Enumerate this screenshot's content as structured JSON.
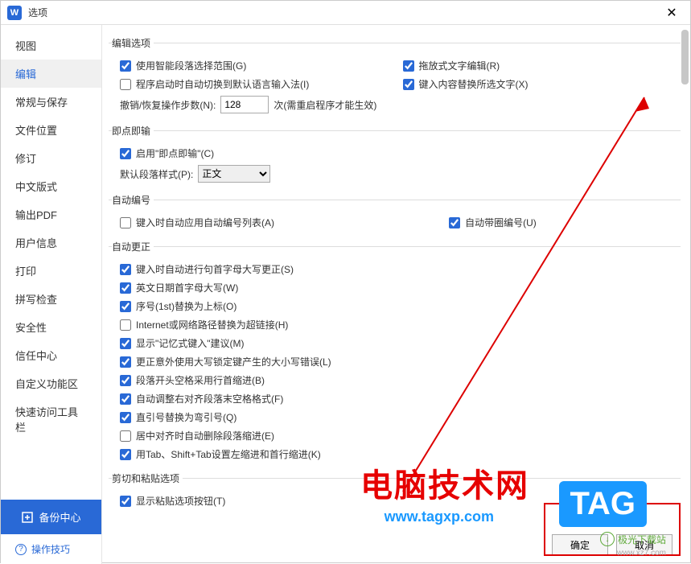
{
  "window": {
    "title": "选项",
    "close": "✕"
  },
  "sidebar": {
    "items": [
      "视图",
      "编辑",
      "常规与保存",
      "文件位置",
      "修订",
      "中文版式",
      "输出PDF",
      "用户信息",
      "打印",
      "拼写检查",
      "安全性",
      "信任中心",
      "自定义功能区",
      "快速访问工具栏"
    ],
    "active_index": 1,
    "backup": "备份中心",
    "help": "操作技巧"
  },
  "groups": {
    "edit": {
      "legend": "编辑选项",
      "smart_para": "使用智能段落选择范围(G)",
      "drag_text": "拖放式文字编辑(R)",
      "auto_switch_ime": "程序启动时自动切换到默认语言输入法(I)",
      "replace_sel": "键入内容替换所选文字(X)",
      "undo_label": "撤销/恢复操作步数(N):",
      "undo_value": "128",
      "undo_suffix": "次(需重启程序才能生效)"
    },
    "click_type": {
      "legend": "即点即输",
      "enable": "启用\"即点即输\"(C)",
      "style_label": "默认段落样式(P):",
      "style_value": "正文"
    },
    "auto_number": {
      "legend": "自动编号",
      "apply_list": "键入时自动应用自动编号列表(A)",
      "circle_number": "自动带圈编号(U)"
    },
    "auto_correct": {
      "legend": "自动更正",
      "items": [
        {
          "label": "键入时自动进行句首字母大写更正(S)",
          "checked": true
        },
        {
          "label": "英文日期首字母大写(W)",
          "checked": true
        },
        {
          "label": "序号(1st)替换为上标(O)",
          "checked": true
        },
        {
          "label": "Internet或网络路径替换为超链接(H)",
          "checked": false
        },
        {
          "label": "显示\"记忆式键入\"建议(M)",
          "checked": true
        },
        {
          "label": "更正意外使用大写锁定键产生的大小写错误(L)",
          "checked": true
        },
        {
          "label": "段落开头空格采用行首缩进(B)",
          "checked": true
        },
        {
          "label": "自动调整右对齐段落末空格格式(F)",
          "checked": true
        },
        {
          "label": "直引号替换为弯引号(Q)",
          "checked": true
        },
        {
          "label": "居中对齐时自动删除段落缩进(E)",
          "checked": false
        },
        {
          "label": "用Tab、Shift+Tab设置左缩进和首行缩进(K)",
          "checked": true
        }
      ]
    },
    "paste": {
      "legend": "剪切和粘贴选项",
      "show_paste_btn": "显示粘贴选项按钮(T)"
    }
  },
  "footer": {
    "ok": "确定",
    "cancel": "取消"
  },
  "watermarks": {
    "site_cn": "电脑技术网",
    "site_url": "www.tagxp.com",
    "tag": "TAG",
    "dl_site": "极光下载站",
    "dl_url": "www.xz7.com"
  }
}
